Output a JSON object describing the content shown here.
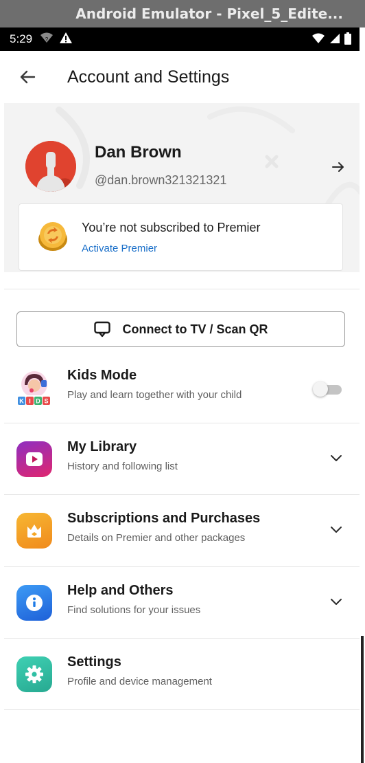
{
  "window": {
    "title": "Android Emulator - Pixel_5_Edite..."
  },
  "status_bar": {
    "time": "5:29",
    "left_icons": [
      "wifi-question-icon",
      "warning-icon"
    ],
    "right_icons": [
      "wifi-icon",
      "signal-icon",
      "battery-icon"
    ]
  },
  "header": {
    "title": "Account and Settings",
    "back_icon": "arrow-left-icon"
  },
  "profile": {
    "name": "Dan Brown",
    "handle": "@dan.brown321321321",
    "arrow_icon": "arrow-right-icon",
    "avatar_color": "#e0432f"
  },
  "premier": {
    "title": "You’re not subscribed to Premier",
    "link": "Activate Premier",
    "link_color": "#1a6fc9",
    "icon": "premier-coin-icon"
  },
  "connect_tv": {
    "label": "Connect to TV / Scan QR",
    "icon": "tv-icon"
  },
  "menu": [
    {
      "title": "Kids Mode",
      "subtitle": "Play and learn together with your child",
      "icon": "kids-icon",
      "badge": "KIDS",
      "control": "toggle",
      "toggle_on": false
    },
    {
      "title": "My Library",
      "subtitle": "History and following list",
      "icon": "play-library-icon",
      "color": "#c2185b",
      "control": "chevron"
    },
    {
      "title": "Subscriptions and Purchases",
      "subtitle": "Details on Premier and other packages",
      "icon": "crown-icon",
      "color": "#f5a623",
      "control": "chevron"
    },
    {
      "title": "Help and Others",
      "subtitle": "Find solutions for your issues",
      "icon": "info-icon",
      "color": "#1e7be6",
      "control": "chevron"
    },
    {
      "title": "Settings",
      "subtitle": "Profile and device management",
      "icon": "gear-icon",
      "color": "#2fbfa4",
      "control": "none"
    }
  ]
}
